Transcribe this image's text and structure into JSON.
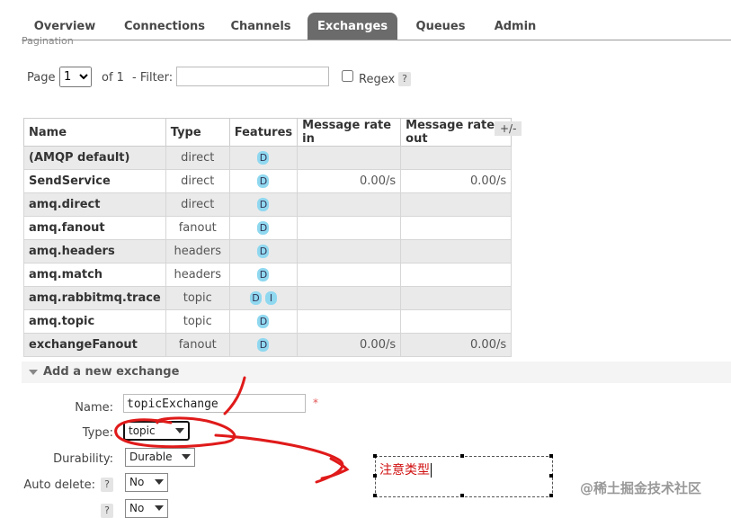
{
  "tabs": [
    {
      "label": "Overview"
    },
    {
      "label": "Connections"
    },
    {
      "label": "Channels"
    },
    {
      "label": "Exchanges",
      "active": true
    },
    {
      "label": "Queues"
    },
    {
      "label": "Admin"
    }
  ],
  "peek_text": "Pagination",
  "pagination": {
    "page_label": "Page",
    "page_value": "1",
    "of_label": "of 1",
    "filter_label": "- Filter:",
    "filter_value": "",
    "regex_label": "Regex",
    "help": "?"
  },
  "table": {
    "headers": [
      "Name",
      "Type",
      "Features",
      "Message rate in",
      "Message rate out"
    ],
    "plus_minus": "+/-",
    "rows": [
      {
        "name": "(AMQP default)",
        "type": "direct",
        "features": [
          "D"
        ],
        "rate_in": "",
        "rate_out": ""
      },
      {
        "name": "SendService",
        "type": "direct",
        "features": [
          "D"
        ],
        "rate_in": "0.00/s",
        "rate_out": "0.00/s"
      },
      {
        "name": "amq.direct",
        "type": "direct",
        "features": [
          "D"
        ],
        "rate_in": "",
        "rate_out": ""
      },
      {
        "name": "amq.fanout",
        "type": "fanout",
        "features": [
          "D"
        ],
        "rate_in": "",
        "rate_out": ""
      },
      {
        "name": "amq.headers",
        "type": "headers",
        "features": [
          "D"
        ],
        "rate_in": "",
        "rate_out": ""
      },
      {
        "name": "amq.match",
        "type": "headers",
        "features": [
          "D"
        ],
        "rate_in": "",
        "rate_out": ""
      },
      {
        "name": "amq.rabbitmq.trace",
        "type": "topic",
        "features": [
          "D",
          "I"
        ],
        "rate_in": "",
        "rate_out": ""
      },
      {
        "name": "amq.topic",
        "type": "topic",
        "features": [
          "D"
        ],
        "rate_in": "",
        "rate_out": ""
      },
      {
        "name": "exchangeFanout",
        "type": "fanout",
        "features": [
          "D"
        ],
        "rate_in": "0.00/s",
        "rate_out": "0.00/s"
      }
    ]
  },
  "add_exchange": {
    "title": "Add a new exchange",
    "name_label": "Name:",
    "name_value": "topicExchange",
    "required_mark": "*",
    "type_label": "Type:",
    "type_value": "topic",
    "durability_label": "Durability:",
    "durability_value": "Durable",
    "auto_delete_label": "Auto delete:",
    "auto_delete_value": "No",
    "internal_value": "No",
    "help": "?"
  },
  "annotation": {
    "note": "注意类型",
    "color": "#d01010"
  },
  "watermark": "@稀土掘金技术社区"
}
